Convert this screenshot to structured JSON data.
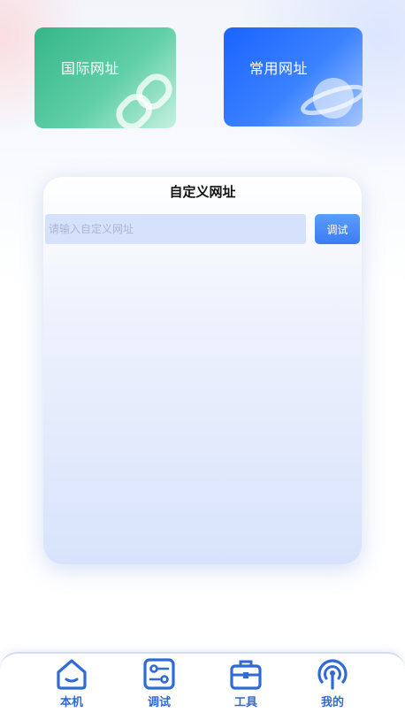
{
  "cards": {
    "international": {
      "label": "国际网址",
      "icon": "link-chain-icon"
    },
    "common": {
      "label": "常用网址",
      "icon": "planet-icon"
    }
  },
  "custom_url": {
    "title": "自定义网址",
    "input": {
      "placeholder": "请输入自定义网址",
      "value": ""
    },
    "test_button": "调试"
  },
  "tabbar": {
    "items": [
      {
        "label": "本机",
        "icon": "home-icon"
      },
      {
        "label": "调试",
        "icon": "debug-icon"
      },
      {
        "label": "工具",
        "icon": "toolbox-icon"
      },
      {
        "label": "我的",
        "icon": "broadcast-icon"
      }
    ]
  },
  "colors": {
    "accent": "#2f6ad6",
    "green_card": "#35b68a",
    "blue_card": "#1a64ff"
  }
}
